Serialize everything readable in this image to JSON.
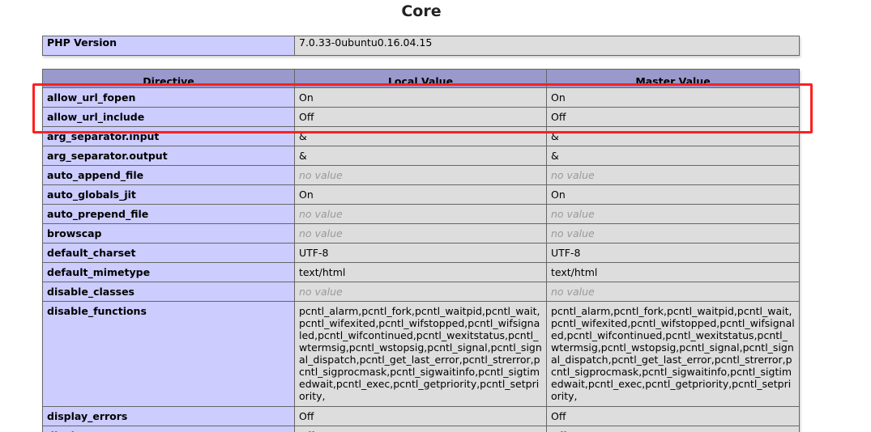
{
  "section_title": "Core",
  "version": {
    "label": "PHP Version",
    "value": "7.0.33-0ubuntu0.16.04.15"
  },
  "headers": {
    "directive": "Directive",
    "local": "Local Value",
    "master": "Master Value"
  },
  "rows": [
    {
      "name": "allow_url_fopen",
      "local": "On",
      "master": "On"
    },
    {
      "name": "allow_url_include",
      "local": "Off",
      "master": "Off"
    },
    {
      "name": "arg_separator.input",
      "local": "&",
      "master": "&"
    },
    {
      "name": "arg_separator.output",
      "local": "&",
      "master": "&"
    },
    {
      "name": "auto_append_file",
      "local": "no value",
      "master": "no value"
    },
    {
      "name": "auto_globals_jit",
      "local": "On",
      "master": "On"
    },
    {
      "name": "auto_prepend_file",
      "local": "no value",
      "master": "no value"
    },
    {
      "name": "browscap",
      "local": "no value",
      "master": "no value"
    },
    {
      "name": "default_charset",
      "local": "UTF-8",
      "master": "UTF-8"
    },
    {
      "name": "default_mimetype",
      "local": "text/html",
      "master": "text/html"
    },
    {
      "name": "disable_classes",
      "local": "no value",
      "master": "no value"
    },
    {
      "name": "disable_functions",
      "local": "pcntl_alarm,pcntl_fork,pcntl_waitpid,pcntl_wait,pcntl_wifexited,pcntl_wifstopped,pcntl_wifsignaled,pcntl_wifcontinued,pcntl_wexitstatus,pcntl_wtermsig,pcntl_wstopsig,pcntl_signal,pcntl_signal_dispatch,pcntl_get_last_error,pcntl_strerror,pcntl_sigprocmask,pcntl_sigwaitinfo,pcntl_sigtimedwait,pcntl_exec,pcntl_getpriority,pcntl_setpriority,",
      "master": "pcntl_alarm,pcntl_fork,pcntl_waitpid,pcntl_wait,pcntl_wifexited,pcntl_wifstopped,pcntl_wifsignaled,pcntl_wifcontinued,pcntl_wexitstatus,pcntl_wtermsig,pcntl_wstopsig,pcntl_signal,pcntl_signal_dispatch,pcntl_get_last_error,pcntl_strerror,pcntl_sigprocmask,pcntl_sigwaitinfo,pcntl_sigtimedwait,pcntl_exec,pcntl_getpriority,pcntl_setpriority,"
    },
    {
      "name": "display_errors",
      "local": "Off",
      "master": "Off"
    },
    {
      "name": "display_startup_errors",
      "local": "Off",
      "master": "Off"
    }
  ],
  "colors": {
    "header_bg": "#9999cc",
    "key_bg": "#ccccff",
    "value_bg": "#dddddd",
    "highlight": "#ff2020"
  }
}
